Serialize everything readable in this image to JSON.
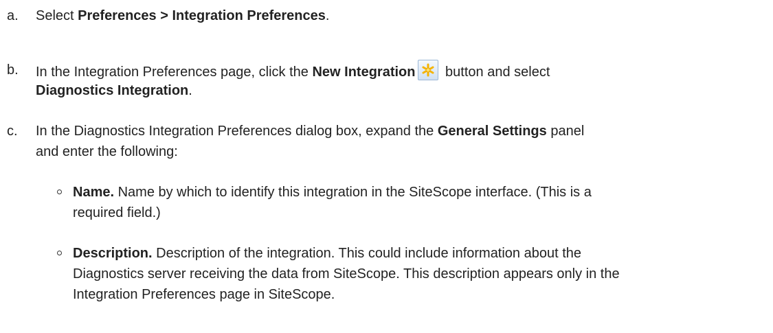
{
  "steps": [
    {
      "marker": "a.",
      "pre": "Select ",
      "bold": "Preferences > Integration Preferences",
      "post": "."
    },
    {
      "marker": "b.",
      "pre": "In the Integration Preferences page, click the ",
      "bold": "New Integration",
      "icon": "new-integration-icon",
      "mid": " button and select",
      "bold2": "Diagnostics Integration",
      "post": "."
    },
    {
      "marker": "c.",
      "pre": "In the Diagnostics Integration Preferences dialog box, expand the ",
      "bold": "General Settings",
      "mid": " panel",
      "line2": "and enter the following:"
    }
  ],
  "fields": [
    {
      "name": "Name.",
      "line1": " Name by which to identify this integration in the SiteScope interface. (This is a",
      "line2": "required field.)"
    },
    {
      "name": "Description.",
      "line1": " Description of the integration. This could include information about the",
      "line2": "Diagnostics server receiving the data from SiteScope. This description appears only in the",
      "line3": "Integration Preferences page in SiteScope."
    }
  ],
  "colors": {
    "text": "#222222",
    "icon_star": "#f5b400",
    "icon_bg": "#cfe0f3"
  }
}
